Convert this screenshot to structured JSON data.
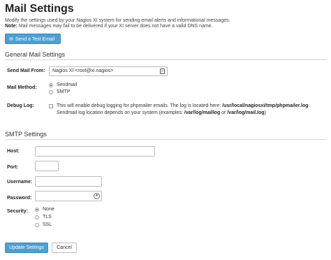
{
  "page": {
    "title": "Mail Settings",
    "description": "Modify the settings used by your Nagios XI system for sending email alerts and informational messages.",
    "note_label": "Note:",
    "note_text": " Mail messages may fail to be delivered if your XI server does not have a valid DNS name.",
    "test_email_button": "Send a Test Email",
    "test_email_icon": "envelope-icon"
  },
  "general": {
    "section_title": "General Mail Settings",
    "send_mail_from_label": "Send Mail From:",
    "send_mail_from_value": "Nagios XI <root@xi.nagios>",
    "mail_method_label": "Mail Method:",
    "mail_methods": [
      "Sendmail",
      "SMTP"
    ],
    "mail_method_selected": "Sendmail",
    "debug_log_label": "Debug Log:",
    "debug_line1_text": "This will enable debug logging for phpmailer emails. The log is located here: ",
    "debug_line1_path": "/usr/local/nagiosxi/tmp/phpmailer.log",
    "debug_line2_text": "Sendmail log location depends on your system (examples: ",
    "debug_line2_path1": "/var/log/maillog",
    "debug_line2_or": " or ",
    "debug_line2_path2": "/var/log/mail.log",
    "debug_line2_end": ")"
  },
  "smtp": {
    "section_title": "SMTP Settings",
    "host_label": "Host:",
    "host_value": "",
    "port_label": "Port:",
    "port_value": "",
    "username_label": "Username:",
    "username_value": "",
    "password_label": "Password:",
    "password_value": "",
    "security_label": "Security:",
    "security_options": [
      "None",
      "TLS",
      "SSL"
    ],
    "security_selected": "None"
  },
  "actions": {
    "update_label": "Update Settings",
    "cancel_label": "Cancel"
  },
  "colors": {
    "accent": "#4a9fd4"
  }
}
